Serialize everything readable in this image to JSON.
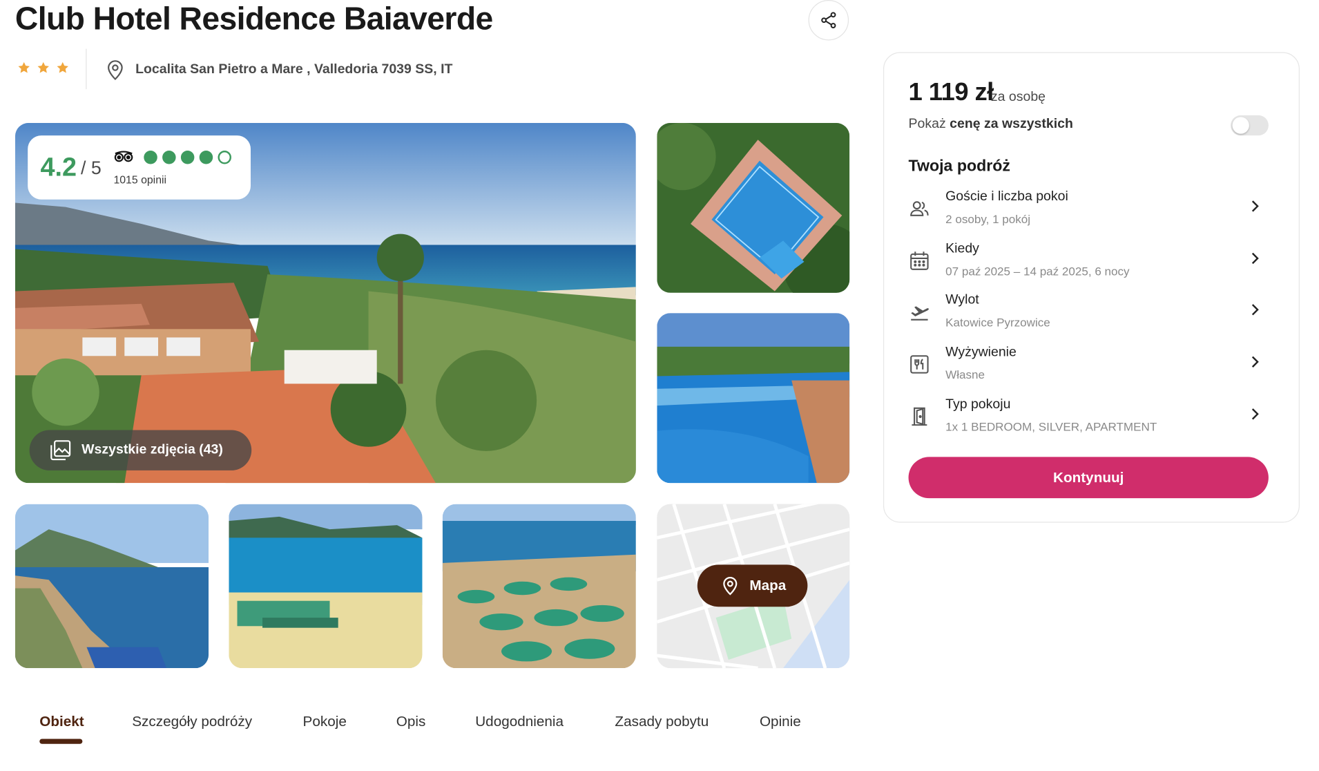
{
  "hotel": {
    "title": "Club Hotel Residence Baiaverde",
    "stars": 3,
    "location": "Localita San Pietro a Mare , Valledoria 7039 SS, IT"
  },
  "rating": {
    "value": "4.2",
    "max": "/ 5",
    "reviews": "1015 opinii",
    "bubbles_filled": 4,
    "bubbles_total": 5,
    "color": "#3d9a5e"
  },
  "gallery": {
    "all_photos_label": "Wszystkie zdjęcia (43)",
    "map_label": "Mapa"
  },
  "tabs": [
    {
      "label": "Obiekt",
      "active": true
    },
    {
      "label": "Szczegóły podróży"
    },
    {
      "label": "Pokoje"
    },
    {
      "label": "Opis"
    },
    {
      "label": "Udogodnienia"
    },
    {
      "label": "Zasady pobytu"
    },
    {
      "label": "Opinie"
    }
  ],
  "booking": {
    "price": "1 119 zł",
    "price_suffix": "za osobę",
    "toggle_prefix": "Pokaż ",
    "toggle_bold": "cenę za wszystkich",
    "toggle_on": false,
    "trip_heading": "Twoja podróż",
    "items": [
      {
        "icon": "guests-icon",
        "label": "Goście i liczba pokoi",
        "value": "2 osoby, 1 pokój"
      },
      {
        "icon": "calendar-icon",
        "label": "Kiedy",
        "value": "07 paź 2025 – 14 paź 2025, 6 nocy"
      },
      {
        "icon": "plane-departure-icon",
        "label": "Wylot",
        "value": "Katowice Pyrzowice"
      },
      {
        "icon": "menu-board-icon",
        "label": "Wyżywienie",
        "value": "Własne"
      },
      {
        "icon": "door-icon",
        "label": "Typ pokoju",
        "value": "1x 1 BEDROOM, SILVER, APARTMENT"
      }
    ],
    "continue_label": "Kontynuuj"
  },
  "colors": {
    "accent": "#d02d6b",
    "brand_dark": "#4f2410",
    "star": "#f0a63c"
  }
}
